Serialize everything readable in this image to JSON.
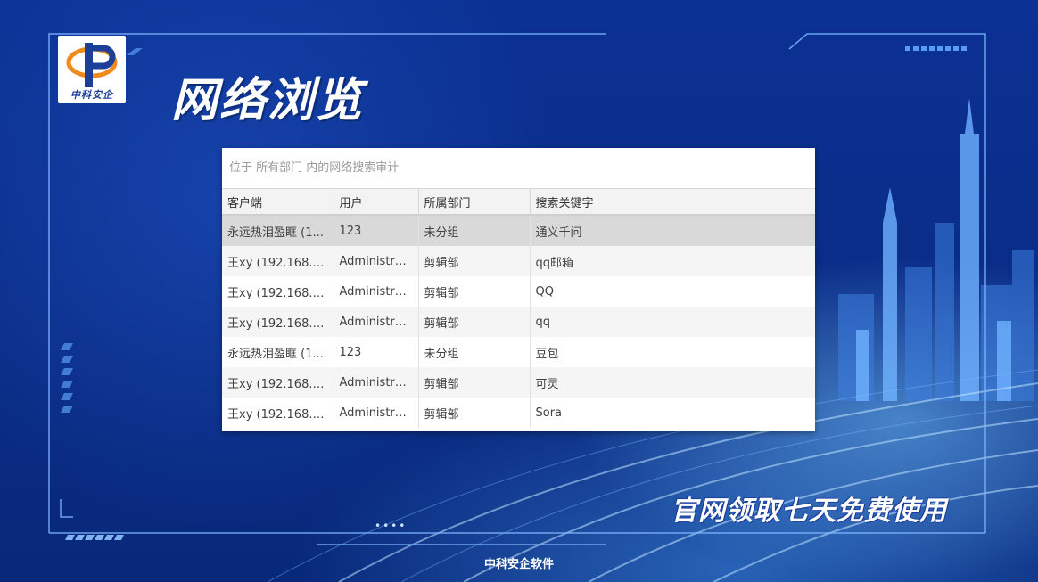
{
  "branding": {
    "logo_text": "中科安企",
    "page_title": "网络浏览",
    "slogan": "官网领取七天免费使用",
    "footer": "中科安企软件"
  },
  "panel": {
    "location_text": "位于 所有部门 内的网络搜索审计",
    "columns": [
      "客户端",
      "用户",
      "所属部门",
      "搜索关键字"
    ],
    "rows": [
      {
        "client": "永远热泪盈眶 (1...",
        "user": "123",
        "dept": "未分组",
        "keyword": "通义千问",
        "selected": true
      },
      {
        "client": "王xy (192.168.3...",
        "user": "Administra...",
        "dept": "剪辑部",
        "keyword": "qq邮箱",
        "selected": false
      },
      {
        "client": "王xy (192.168.3...",
        "user": "Administra...",
        "dept": "剪辑部",
        "keyword": "QQ",
        "selected": false
      },
      {
        "client": "王xy (192.168.3...",
        "user": "Administra...",
        "dept": "剪辑部",
        "keyword": "qq",
        "selected": false
      },
      {
        "client": "永远热泪盈眶 (1...",
        "user": "123",
        "dept": "未分组",
        "keyword": "豆包",
        "selected": false
      },
      {
        "client": "王xy (192.168.3...",
        "user": "Administra...",
        "dept": "剪辑部",
        "keyword": "可灵",
        "selected": false
      },
      {
        "client": "王xy (192.168.3...",
        "user": "Administra...",
        "dept": "剪辑部",
        "keyword": "Sora",
        "selected": false
      }
    ]
  },
  "colors": {
    "background": "#0a2f8c",
    "frame_line": "#7fb6ff",
    "selected_row": "#d9d9d9",
    "logo_blue": "#1c3f97",
    "logo_orange": "#f08a1c"
  }
}
